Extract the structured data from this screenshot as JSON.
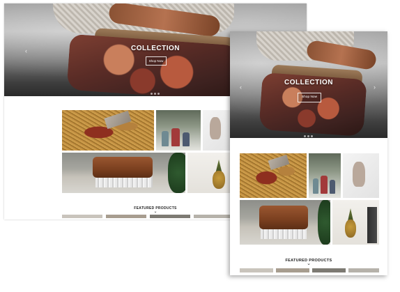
{
  "hero": {
    "title": "COLLECTION",
    "button_label": "Shop Now",
    "prev_arrow": "‹",
    "next_arrow": "›"
  },
  "featured": {
    "heading": "FEATURED PRODUCTS",
    "chevron": "⌄"
  },
  "icons": [
    "chevron-left-icon",
    "chevron-right-icon",
    "chevron-down-icon"
  ],
  "colors": {
    "hero_text": "#ffffff",
    "heading_text": "#222222",
    "page_bg": "#ffffff"
  }
}
